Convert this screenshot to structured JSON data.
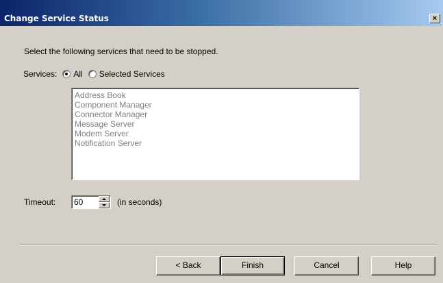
{
  "window": {
    "title": "Change Service Status",
    "close_label": "×"
  },
  "instructions": "Select the following services that need to be stopped.",
  "services": {
    "label": "Services:",
    "option_all": "All",
    "option_selected": "Selected Services",
    "selected_option": "All",
    "items": [
      "Address  Book",
      "Component Manager",
      "Connector Manager",
      "Message Server",
      "Modem Server",
      "Notification Server"
    ]
  },
  "timeout": {
    "label": "Timeout:",
    "value": "60",
    "unit": "(in seconds)"
  },
  "buttons": {
    "back": "< Back",
    "finish": "Finish",
    "cancel": "Cancel",
    "help": "Help"
  }
}
